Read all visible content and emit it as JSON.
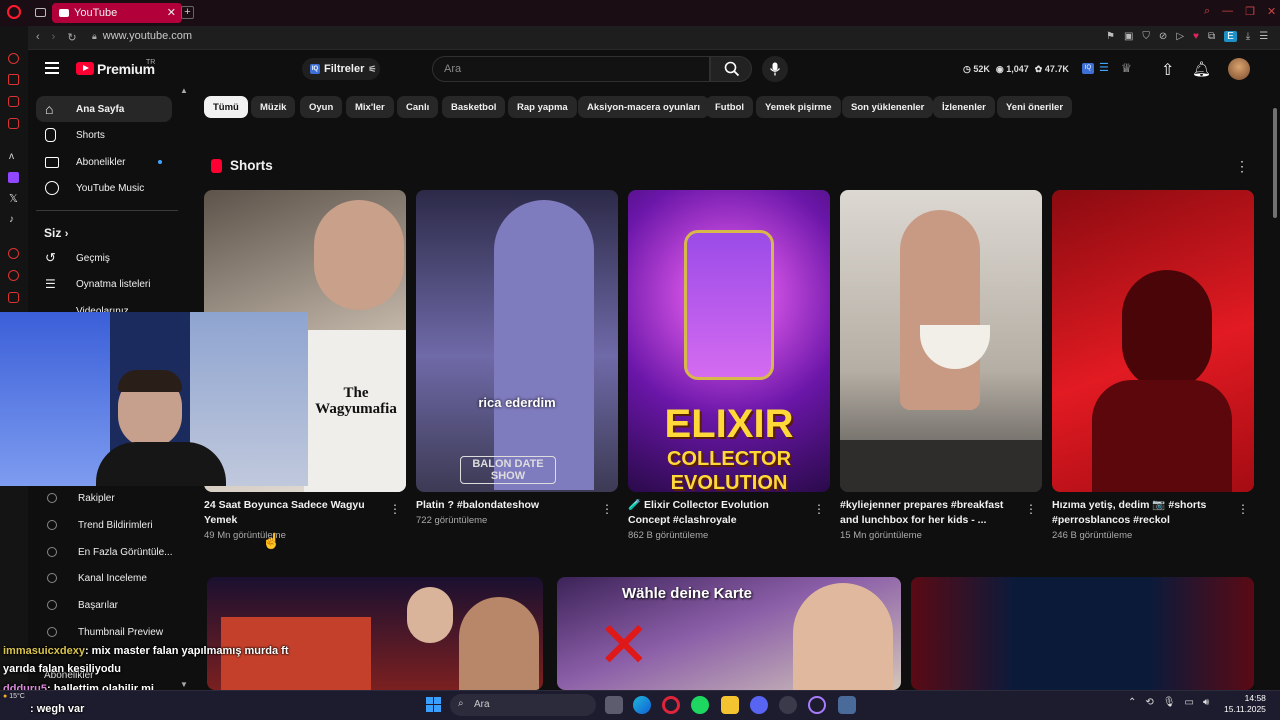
{
  "browser": {
    "tab_title": "YouTube",
    "url": "www.youtube.com"
  },
  "header": {
    "logo_text": "Premium",
    "logo_sup": "TR",
    "filters_label": "Filtreler",
    "filters_badge": "IQ",
    "search_placeholder": "Ara",
    "stats": [
      "52K",
      "1,047",
      "47.7K"
    ]
  },
  "sidebar": {
    "items": [
      {
        "label": "Ana Sayfa"
      },
      {
        "label": "Shorts"
      },
      {
        "label": "Abonelikler"
      },
      {
        "label": "YouTube Music"
      }
    ],
    "you_label": "Siz",
    "you_items": [
      {
        "label": "Geçmiş"
      },
      {
        "label": "Oynatma listeleri"
      },
      {
        "label": "Videolarınız"
      }
    ],
    "tool_items": [
      {
        "label": "Rakipler"
      },
      {
        "label": "Trend Bildirimleri"
      },
      {
        "label": "En Fazla Görüntüle..."
      },
      {
        "label": "Kanal Inceleme"
      },
      {
        "label": "Başarılar"
      },
      {
        "label": "Thumbnail Preview"
      }
    ],
    "subs_label": "Abonelikler"
  },
  "chips": [
    "Tümü",
    "Müzik",
    "Oyun",
    "Mix'ler",
    "Canlı",
    "Basketbol",
    "Rap yapma",
    "Aksiyon-macera oyunları",
    "Futbol",
    "Yemek pişirme",
    "Son yüklenenler",
    "İzlenenler",
    "Yeni öneriler"
  ],
  "shorts": {
    "section_title": "Shorts",
    "items": [
      {
        "title": "24 Saat Boyunca Sadece Wagyu Yemek",
        "views": "49 Mn görüntüleme",
        "overlay": "The Wagyumafia",
        "bg": "#7a6a5c"
      },
      {
        "title": "Platin ? #balondateshow",
        "views": "722 görüntüleme",
        "overlay": "rica ederdim",
        "overlay2": "BALON DATE SHOW",
        "bg": "#4b4a70"
      },
      {
        "title": "🧪 Elixir Collector Evolution Concept #clashroyale",
        "views": "862 B görüntüleme",
        "overlay": "ELIXIR",
        "overlay2": "COLLECTOR",
        "overlay3": "EVOLUTION",
        "bg": "#7a2ab5"
      },
      {
        "title": "#kyliejenner prepares #breakfast and lunchbox for her kids - ...",
        "views": "15 Mn görüntüleme",
        "bg": "#b8b2aa"
      },
      {
        "title": "Hızıma yetiş, dedim 📷 #shorts #perrosblancos #reckol",
        "views": "246 B görüntüleme",
        "bg": "#c0101a"
      }
    ]
  },
  "videos": [
    {
      "bg": "#3b1010"
    },
    {
      "overlay": "Wähle deine Karte",
      "bg": "#5a3a6e"
    },
    {
      "bg": "#4a0c14"
    }
  ],
  "chat": [
    {
      "user": "immasuicxdexy",
      "msg": ": mix master falan yapılmamış murda ft",
      "color": "#d9c34a"
    },
    {
      "user": "",
      "msg": "yarıda falan kesiliyodu",
      "color": "#d9c34a"
    },
    {
      "user": "ddduru5",
      "msg": ": hallettim olabilir mi",
      "color": "#d98ad9"
    },
    {
      "user": "",
      "msg": ": wegh var",
      "color": "#9fd36b"
    }
  ],
  "taskbar": {
    "search_label": "Ara",
    "weather": "15°C",
    "time": "14:58",
    "date": "15.11.2025"
  }
}
